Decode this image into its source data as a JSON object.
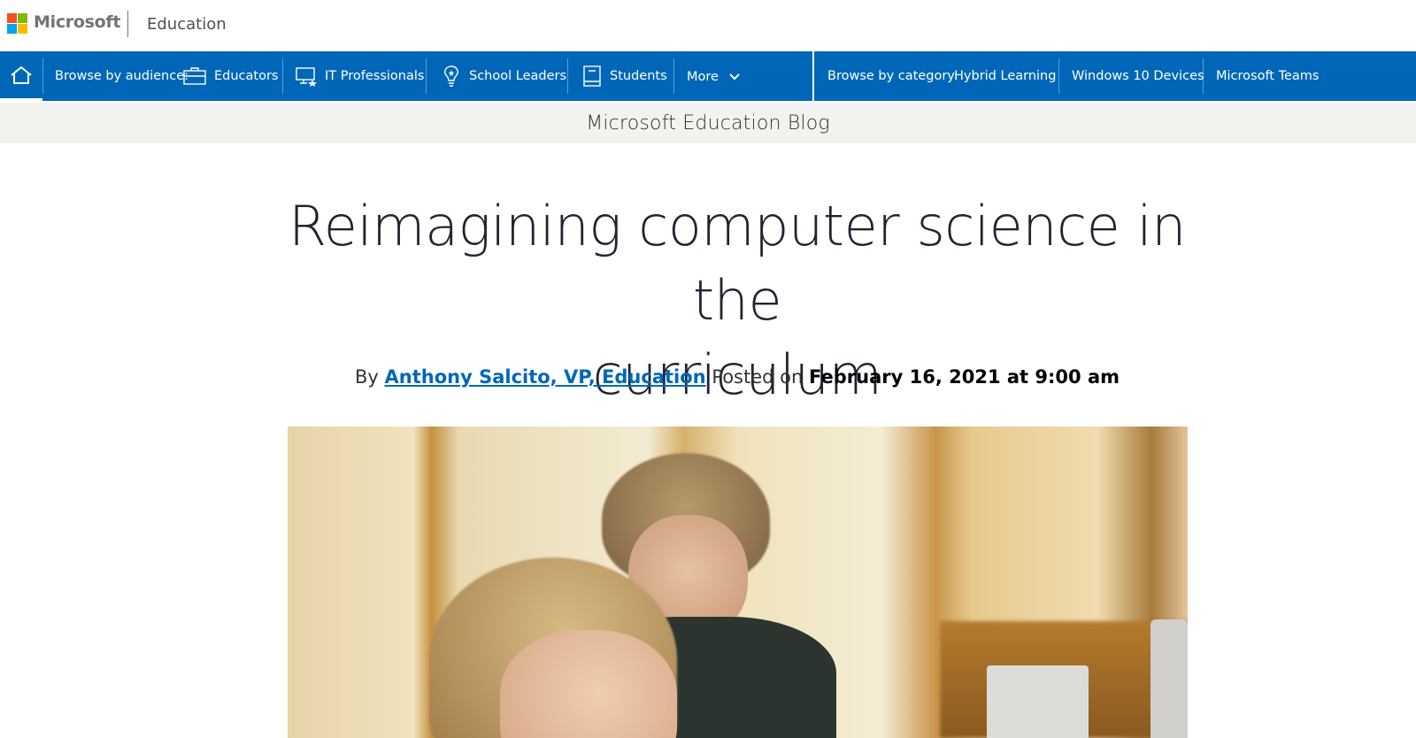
{
  "brand": {
    "company": "Microsoft",
    "section": "Education"
  },
  "nav": {
    "audience_label": "Browse by audience:",
    "audience_items": [
      {
        "label": "Educators",
        "icon": "briefcase-icon"
      },
      {
        "label": "IT Professionals",
        "icon": "devices-icon"
      },
      {
        "label": "School Leaders",
        "icon": "lightbulb-icon"
      },
      {
        "label": "Students",
        "icon": "book-icon"
      }
    ],
    "more_label": "More",
    "category_label": "Browse by category:",
    "category_items": [
      "Hybrid Learning",
      "Windows 10 Devices",
      "Microsoft Teams"
    ],
    "accent_color": "#0067b8"
  },
  "blog": {
    "title": "Microsoft Education Blog"
  },
  "article": {
    "headline_line1": "Reimagining computer science in the",
    "headline_line2": "curriculum",
    "by_prefix": "By",
    "author": "Anthony Salcito, VP, Education",
    "posted_prefix": "Posted on",
    "date": "February 16, 2021 at 9:00 am"
  }
}
